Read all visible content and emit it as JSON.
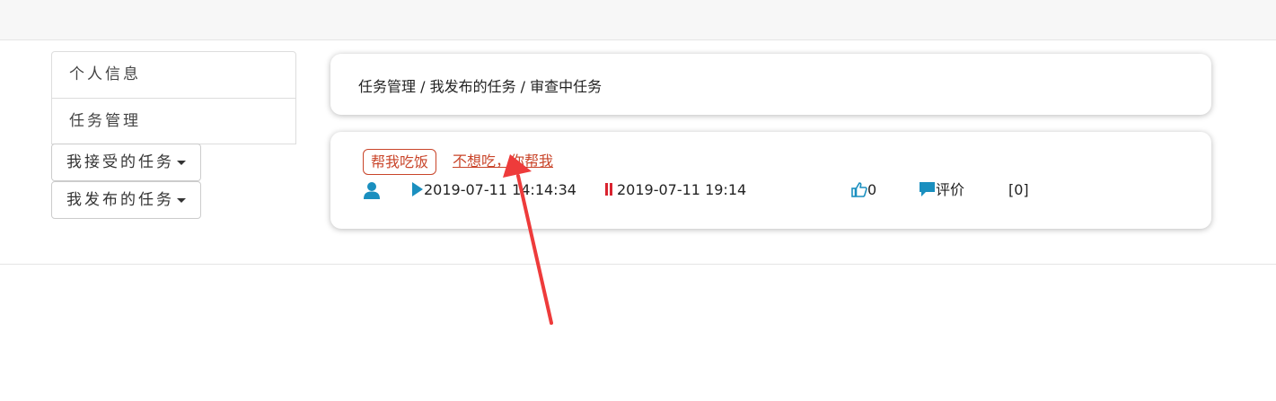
{
  "sidebar": {
    "items": [
      {
        "label": "个人信息"
      },
      {
        "label": "任务管理"
      }
    ],
    "dropdowns": [
      {
        "label": "我接受的任务"
      },
      {
        "label": "我发布的任务"
      }
    ]
  },
  "breadcrumb": {
    "text": "任务管理 / 我发布的任务 / 审查中任务"
  },
  "task": {
    "tag": "帮我吃饭",
    "title": "不想吃，你帮我",
    "start_time": "2019-07-11 14:14:34",
    "deadline": "2019-07-11 19:14",
    "likes": "0",
    "comment_label": "评价",
    "comment_count": "[0]"
  },
  "icons": {
    "user": "user-icon",
    "start": "play-icon",
    "deadline": "pause-icon",
    "like": "thumbs-up-icon",
    "comment": "comment-icon"
  },
  "colors": {
    "accent": "#1a8fbf",
    "tag_red": "#c9452a",
    "pause_red": "#d9232f",
    "annotation_arrow": "#ee3b3b"
  }
}
